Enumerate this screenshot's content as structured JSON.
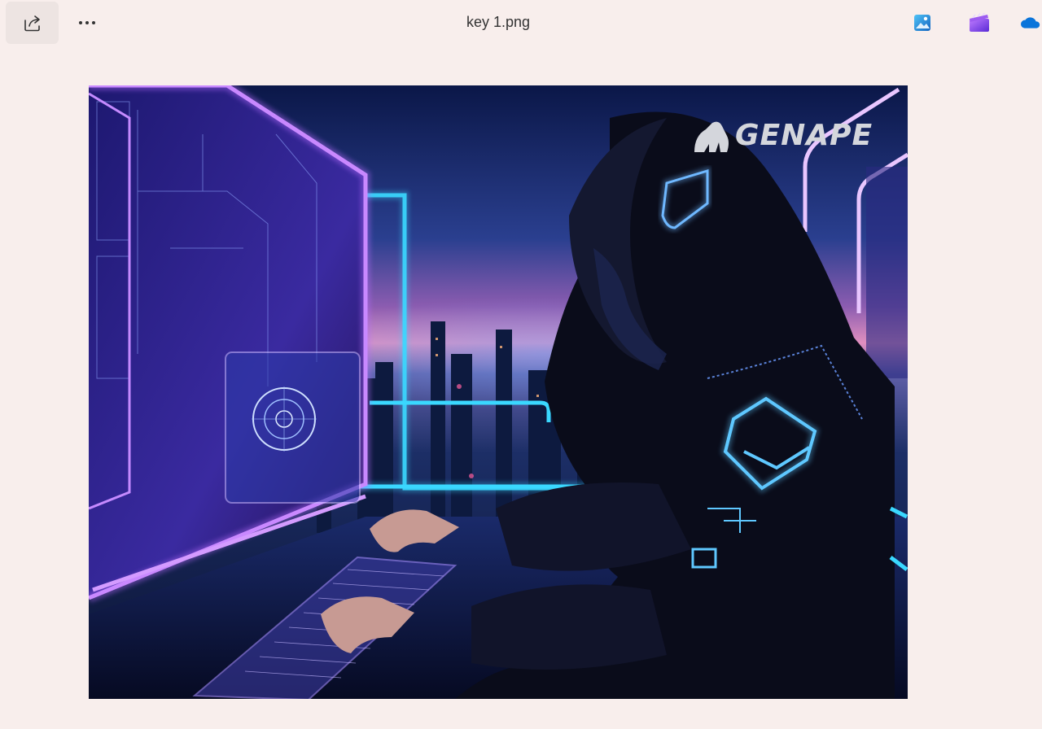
{
  "window": {
    "title": "key 1.png"
  },
  "toolbar": {
    "share_icon": "share-icon",
    "more_icon": "more-options-icon"
  },
  "app_icons": [
    {
      "name": "photos-editor-icon",
      "color": "#1e88e5"
    },
    {
      "name": "clipchamp-icon",
      "color": "#7b3fe4"
    },
    {
      "name": "onedrive-icon",
      "color": "#0a74da"
    }
  ],
  "image": {
    "watermark": "GENAPE",
    "subject": "hooded figure typing at neon holographic terminal overlooking city skyline at dusk"
  },
  "colors": {
    "background": "#f8eeec",
    "neon_purple": "#b86cff",
    "neon_cyan": "#3ad8ff"
  }
}
